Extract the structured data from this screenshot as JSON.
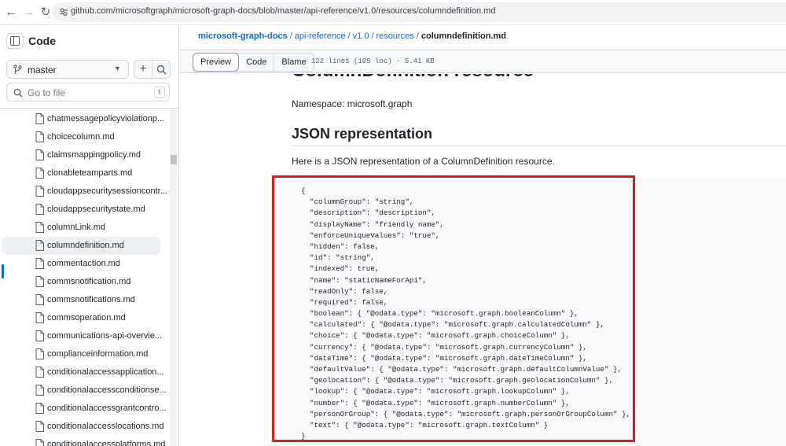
{
  "browser": {
    "url": "github.com/microsoftgraph/microsoft-graph-docs/blob/master/api-reference/v1.0/resources/columndefinition.md"
  },
  "sidebar": {
    "title": "Code",
    "branch": "master",
    "search_placeholder": "Go to file",
    "search_shortcut": "t",
    "files": [
      "chatmessagepolicyviolationp...",
      "choicecolumn.md",
      "claimsmappingpolicy.md",
      "clonableteamparts.md",
      "cloudappsecuritysessioncontr...",
      "cloudappsecuritystate.md",
      "columnLink.md",
      "columndefinition.md",
      "commentaction.md",
      "commsnotification.md",
      "commsnotifications.md",
      "commsoperation.md",
      "communications-api-overvie...",
      "complianceinformation.md",
      "conditionalaccessapplication...",
      "conditionalaccessconditionse...",
      "conditionalaccessgrantcontro...",
      "conditionalaccesslocations.md",
      "conditionalaccessplatforms.md"
    ],
    "active_index": 7
  },
  "breadcrumb": {
    "repo": "microsoft-graph-docs",
    "parts": [
      "api-reference",
      "v1.0",
      "resources"
    ],
    "current": "columndefinition.md"
  },
  "toolbar": {
    "preview": "Preview",
    "code": "Code",
    "blame": "Blame",
    "meta": "122 lines (105 loc) · 5.41 KB"
  },
  "doc": {
    "h1": "ColumnDefinition resource",
    "namespace": "Namespace: microsoft.graph",
    "h2": "JSON representation",
    "intro": "Here is a JSON representation of a ColumnDefinition resource.",
    "code_lines": [
      "{",
      "  \"columnGroup\": \"string\",",
      "  \"description\": \"description\",",
      "  \"displayName\": \"friendly name\",",
      "  \"enforceUniqueValues\": \"true\",",
      "  \"hidden\": false,",
      "  \"id\": \"string\",",
      "  \"indexed\": true,",
      "  \"name\": \"staticNameForApi\",",
      "  \"readOnly\": false,",
      "  \"required\": false,",
      "  \"boolean\": { \"@odata.type\": \"microsoft.graph.booleanColumn\" },",
      "  \"calculated\": { \"@odata.type\": \"microsoft.graph.calculatedColumn\" },",
      "  \"choice\": { \"@odata.type\": \"microsoft.graph.choiceColumn\" },",
      "  \"currency\": { \"@odata.type\": \"microsoft.graph.currencyColumn\" },",
      "  \"dateTime\": { \"@odata.type\": \"microsoft.graph.dateTimeColumn\" },",
      "  \"defaultValue\": { \"@odata.type\": \"microsoft.graph.defaultColumnValue\" },",
      "  \"geolocation\": { \"@odata.type\": \"microsoft.graph.geolocationColumn\" },",
      "  \"lookup\": { \"@odata.type\": \"microsoft.graph.lookupColumn\" },",
      "  \"number\": { \"@odata.type\": \"microsoft.graph.numberColumn\" },",
      "  \"personOrGroup\": { \"@odata.type\": \"microsoft.graph.personOrGroupColumn\" },",
      "  \"text\": { \"@odata.type\": \"microsoft.graph.textColumn\" }",
      "}"
    ]
  },
  "colors": {
    "link": "#0969da",
    "highlight": "#d61f1f"
  }
}
